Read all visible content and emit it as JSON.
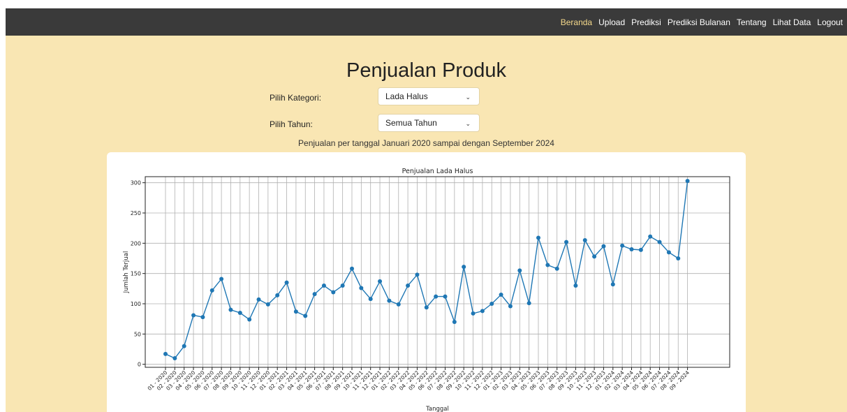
{
  "nav": {
    "items": [
      "Beranda",
      "Upload",
      "Prediksi",
      "Prediksi Bulanan",
      "Tentang",
      "Lihat Data",
      "Logout"
    ],
    "active": "Beranda",
    "active_color": "#f5d98b",
    "bar_color": "#3a3a3a"
  },
  "page": {
    "title": "Penjualan Produk",
    "background": "#f9e6b3"
  },
  "filters": {
    "category_label": "Pilih Kategori:",
    "category_value": "Lada Halus",
    "year_label": "Pilih Tahun:",
    "year_value": "Semua Tahun"
  },
  "period_text": "Penjualan per tanggal Januari 2020 sampai dengan September 2024",
  "chart_data": {
    "type": "line",
    "title": "Penjualan Lada Halus",
    "xlabel": "Tanggal",
    "ylabel": "Jumlah Terjual",
    "ylim": [
      -5,
      310
    ],
    "yticks": [
      0,
      50,
      100,
      150,
      200,
      250,
      300
    ],
    "grid": true,
    "line_color": "#1f77b4",
    "categories": [
      "01 - 2020",
      "02 - 2020",
      "03 - 2020",
      "04 - 2020",
      "05 - 2020",
      "06 - 2020",
      "07 - 2020",
      "08 - 2020",
      "09 - 2020",
      "10 - 2020",
      "11 - 2020",
      "12 - 2020",
      "01 - 2021",
      "02 - 2021",
      "03 - 2021",
      "04 - 2021",
      "05 - 2021",
      "06 - 2021",
      "07 - 2021",
      "08 - 2021",
      "09 - 2021",
      "10 - 2021",
      "11 - 2021",
      "12 - 2021",
      "01 - 2022",
      "02 - 2022",
      "03 - 2022",
      "04 - 2022",
      "05 - 2022",
      "06 - 2022",
      "07 - 2022",
      "08 - 2022",
      "09 - 2022",
      "10 - 2022",
      "11 - 2022",
      "12 - 2022",
      "01 - 2023",
      "02 - 2023",
      "03 - 2023",
      "04 - 2023",
      "05 - 2023",
      "06 - 2023",
      "07 - 2023",
      "08 - 2023",
      "09 - 2023",
      "10 - 2023",
      "11 - 2023",
      "12 - 2023",
      "01 - 2024",
      "02 - 2024",
      "03 - 2024",
      "04 - 2024",
      "05 - 2024",
      "06 - 2024",
      "07 - 2024",
      "08 - 2024",
      "09 - 2024"
    ],
    "values": [
      17,
      10,
      30,
      81,
      78,
      122,
      141,
      90,
      85,
      74,
      107,
      99,
      114,
      135,
      87,
      80,
      116,
      130,
      119,
      130,
      158,
      126,
      108,
      137,
      105,
      99,
      130,
      148,
      94,
      112,
      112,
      70,
      161,
      84,
      88,
      100,
      115,
      96,
      155,
      101,
      209,
      164,
      158,
      202,
      130,
      205,
      178,
      195,
      132,
      196,
      190,
      189,
      211,
      202,
      185,
      175,
      303
    ]
  }
}
